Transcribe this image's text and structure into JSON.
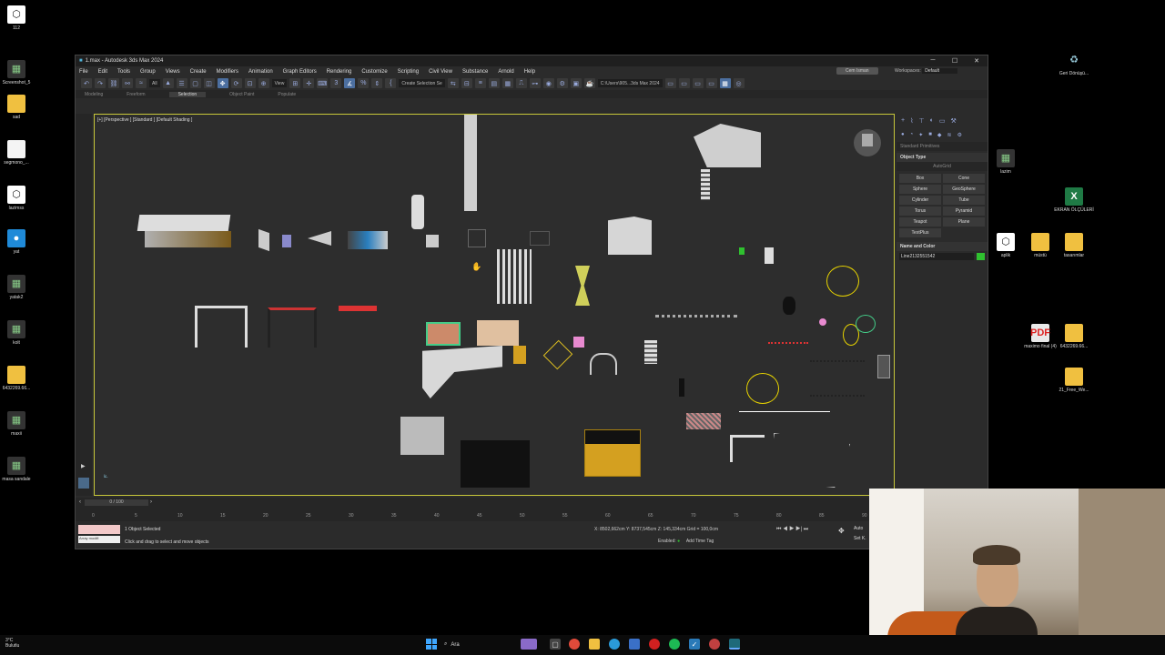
{
  "desktop_left": [
    {
      "label": "112",
      "kind": "app"
    },
    {
      "label": "Screenshot_5",
      "kind": "pad"
    },
    {
      "label": "sad",
      "kind": "folder"
    },
    {
      "label": "segmono_...",
      "kind": "doc"
    },
    {
      "label": "lazimss",
      "kind": "app"
    },
    {
      "label": "yat",
      "kind": "blue"
    },
    {
      "label": "yatak2",
      "kind": "pad"
    },
    {
      "label": "kolt",
      "kind": "pad"
    },
    {
      "label": "6432269.66...",
      "kind": "folder"
    },
    {
      "label": "maxii",
      "kind": "pad"
    },
    {
      "label": "masa sandale",
      "kind": "pad"
    }
  ],
  "desktop_right": [
    {
      "label": "Geri Dönüşü...",
      "kind": "bin"
    },
    {
      "label": "lazim",
      "kind": "pad"
    },
    {
      "label": "EKRAN ÖLÇÜLERİ",
      "kind": "xls"
    },
    {
      "label": "aplik",
      "kind": "app"
    },
    {
      "label": "müstü",
      "kind": "folder"
    },
    {
      "label": "tasarımlar",
      "kind": "folder"
    },
    {
      "label": "maximo final (4)",
      "kind": "pdf"
    },
    {
      "label": "6432269.66...",
      "kind": "folder"
    },
    {
      "label": "21_Free_We...",
      "kind": "folder"
    }
  ],
  "window": {
    "title": "1.max - Autodesk 3ds Max 2024",
    "menu": [
      "File",
      "Edit",
      "Tools",
      "Group",
      "Views",
      "Create",
      "Modifiers",
      "Animation",
      "Graph Editors",
      "Rendering",
      "Customize",
      "Scripting",
      "Civil View",
      "Substance",
      "Arnold",
      "Help"
    ],
    "user": "Cem Isman",
    "workspace_label": "Workspaces:",
    "workspace_value": "Default",
    "toolbar_filter": "All",
    "view_select": "View",
    "selection_set": "Create Selection Se",
    "project_path": "C:\\Users\\905...3ds Max 2024",
    "ribbon_tabs": [
      "Modeling",
      "Freeform",
      "Selection",
      "Object Paint",
      "Populate"
    ],
    "ribbon_active": "Selection"
  },
  "viewport": {
    "label": "[+] [Perspective ] [Standard ] [Default Shading ]"
  },
  "command_panel": {
    "category": "Standard Primitives",
    "object_type_title": "Object Type",
    "autogrid": "AutoGrid",
    "primitives": [
      "Box",
      "Cone",
      "Sphere",
      "GeoSphere",
      "Cylinder",
      "Tube",
      "Torus",
      "Pyramid",
      "Teapot",
      "Plane",
      "TextPlus"
    ],
    "name_color_title": "Name and Color",
    "object_name": "Line2132551542",
    "object_color": "#2fc02f"
  },
  "timeline": {
    "frame": "0 / 100",
    "ticks": [
      "0",
      "5",
      "10",
      "15",
      "20",
      "25",
      "30",
      "35",
      "40",
      "45",
      "50",
      "55",
      "60",
      "65",
      "70",
      "75",
      "80",
      "85",
      "90"
    ]
  },
  "status": {
    "selected": "1 Object Selected",
    "hint": "Click and drag to select and move objects",
    "maxscript": "Array modifi",
    "x": "X: 8502,662cm",
    "y": "Y: 8737,545cm",
    "z": "Z: 145,334cm",
    "grid": "Grid = 100,0cm",
    "enabled": "Enabled:",
    "add_time_tag": "Add Time Tag",
    "auto": "Auto",
    "set": "Set K."
  },
  "taskbar": {
    "temperature": "3°C",
    "weather": "Bulutlu",
    "search": "Ara"
  }
}
